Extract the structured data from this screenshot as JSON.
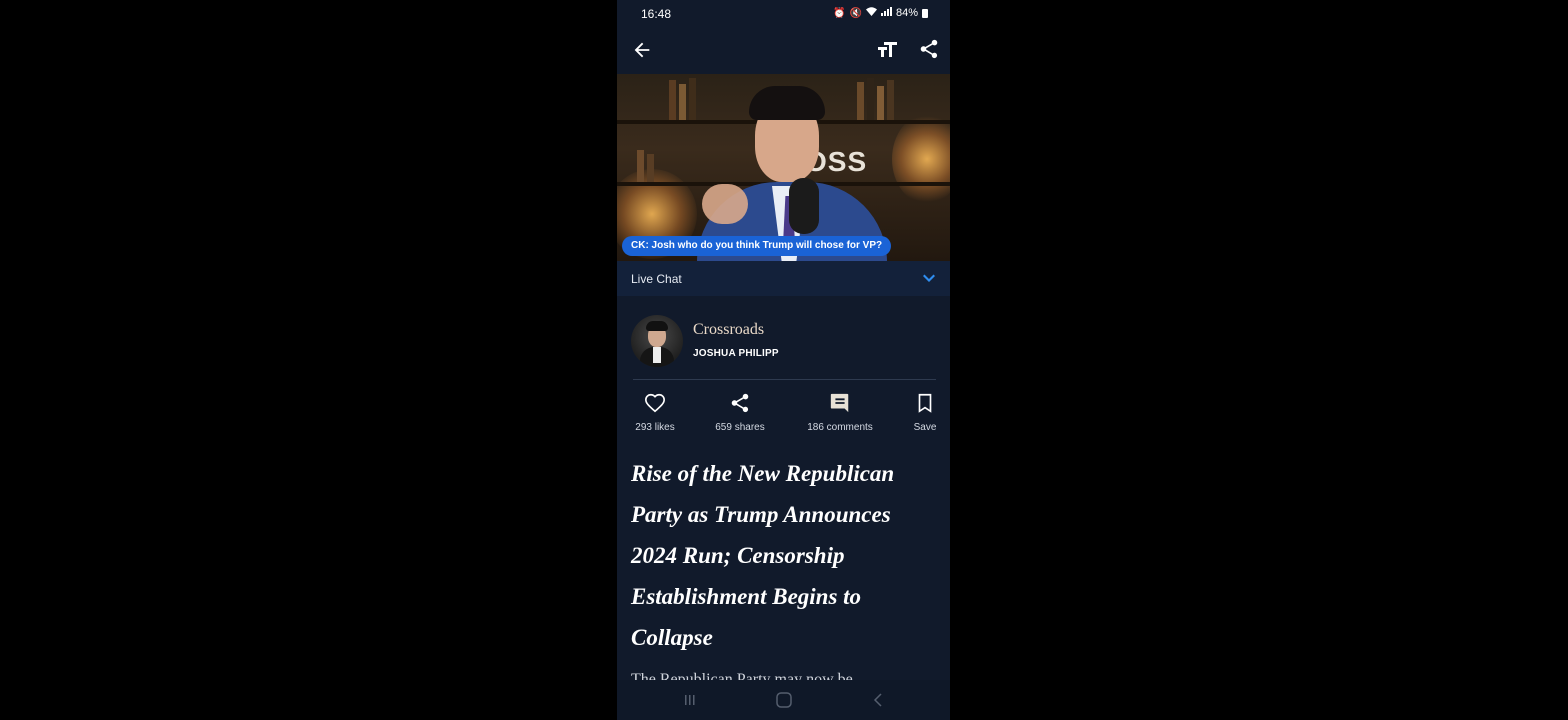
{
  "status_bar": {
    "time": "16:48",
    "battery": "84%"
  },
  "video": {
    "sign_text": "OSS",
    "chat_message": "CK: Josh who do you think Trump will chose for VP?"
  },
  "live_chat": {
    "label": "Live Chat"
  },
  "channel": {
    "name": "Crossroads",
    "host": "JOSHUA PHILIPP"
  },
  "actions": {
    "likes": "293 likes",
    "shares": "659 shares",
    "comments": "186 comments",
    "save": "Save"
  },
  "article": {
    "title": "Rise of the New Republican Party as Trump Announces 2024 Run; Censorship Establishment Begins to Collapse",
    "snippet": "The Republican Party may now be"
  },
  "colors": {
    "background": "#111a2b",
    "accent": "#1a63d6",
    "chevron": "#2f8df0",
    "channel_name": "#e9d9c8"
  }
}
